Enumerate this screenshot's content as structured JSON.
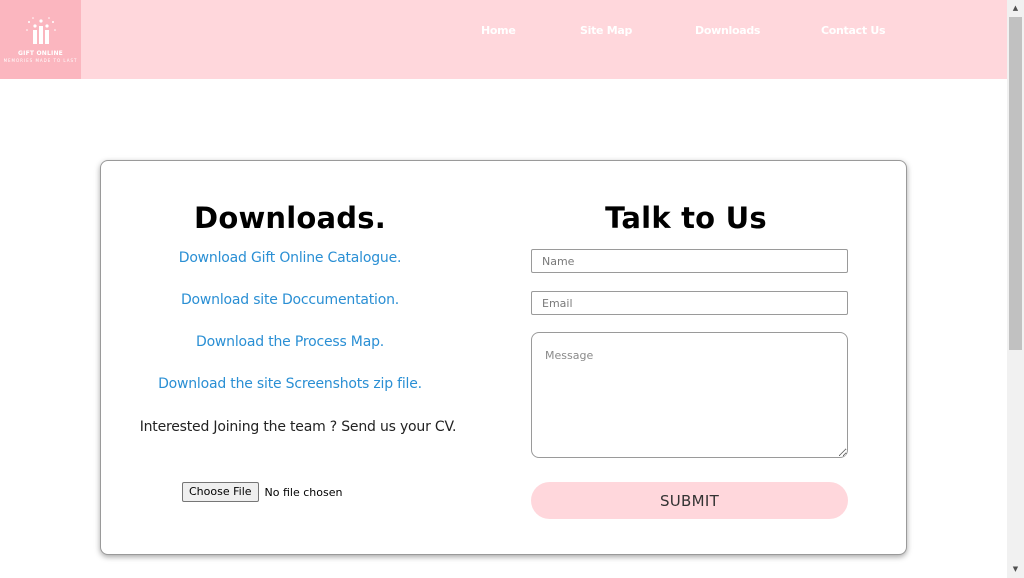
{
  "navbar": {
    "logo": {
      "name": "GIFT ONLINE",
      "tagline": "MEMORIES MADE TO LAST"
    },
    "links": [
      {
        "label": "Home"
      },
      {
        "label": "Site Map"
      },
      {
        "label": "Downloads"
      },
      {
        "label": "Contact Us"
      }
    ]
  },
  "downloads": {
    "heading": "Downloads.",
    "links": [
      {
        "label": "Download Gift Online Catalogue."
      },
      {
        "label": "Download site Doccumentation."
      },
      {
        "label": "Download the Process Map."
      },
      {
        "label": "Download the site Screenshots zip file."
      }
    ],
    "team_text": "Interested Joining the team ? Send us your CV.",
    "file_input": {
      "button_label": "Choose File",
      "status": "No file chosen"
    }
  },
  "contact": {
    "heading": "Talk to Us",
    "name_placeholder": "Name",
    "email_placeholder": "Email",
    "message_placeholder": "Message",
    "submit_label": "SUBMIT"
  },
  "colors": {
    "navbar_bg": "#ffd7dc",
    "logo_bg": "#fbb6bf",
    "link_blue": "#2a8fd4",
    "submit_bg": "#ffd7dc"
  }
}
